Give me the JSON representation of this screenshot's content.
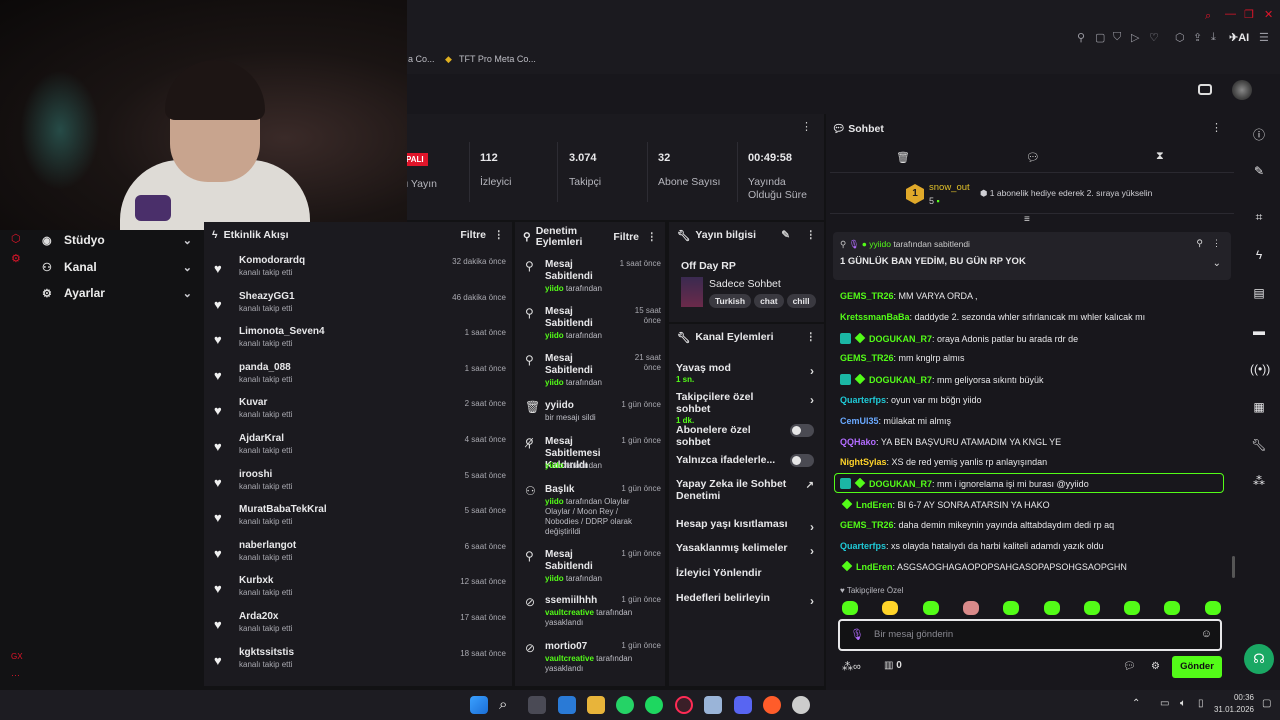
{
  "browser": {
    "tabs": [
      {
        "label": "a Co..."
      },
      {
        "label": "TFT Pro Meta Co..."
      }
    ],
    "ai_label": "AI"
  },
  "sidebar": {
    "items": [
      {
        "label": "Stüdyo",
        "icon": "camera-icon"
      },
      {
        "label": "Kanal",
        "icon": "people-icon"
      },
      {
        "label": "Ayarlar",
        "icon": "gear-icon"
      }
    ]
  },
  "stats": {
    "status_badge": "PALI",
    "items": [
      {
        "value": "",
        "label": "lu Yayın"
      },
      {
        "value": "112",
        "label": "İzleyici"
      },
      {
        "value": "3.074",
        "label": "Takipçi"
      },
      {
        "value": "32",
        "label": "Abone Sayısı"
      },
      {
        "value": "00:49:58",
        "label": "Yayında Olduğu Süre"
      }
    ]
  },
  "activity": {
    "title": "Etkinlik Akışı",
    "filter": "Filtre",
    "items": [
      {
        "name": "Komodorardq",
        "sub": "kanalı takip etti",
        "time": "32 dakika önce"
      },
      {
        "name": "SheazyGG1",
        "sub": "kanalı takip etti",
        "time": "46 dakika önce"
      },
      {
        "name": "Limonota_Seven4",
        "sub": "kanalı takip etti",
        "time": "1 saat önce"
      },
      {
        "name": "panda_088",
        "sub": "kanalı takip etti",
        "time": "1 saat önce"
      },
      {
        "name": "Kuvar",
        "sub": "kanalı takip etti",
        "time": "2 saat önce"
      },
      {
        "name": "AjdarKral",
        "sub": "kanalı takip etti",
        "time": "4 saat önce"
      },
      {
        "name": "irooshi",
        "sub": "kanalı takip etti",
        "time": "5 saat önce"
      },
      {
        "name": "MuratBabaTekKral",
        "sub": "kanalı takip etti",
        "time": "5 saat önce"
      },
      {
        "name": "naberlangot",
        "sub": "kanalı takip etti",
        "time": "6 saat önce"
      },
      {
        "name": "Kurbxk",
        "sub": "kanalı takip etti",
        "time": "12 saat önce"
      },
      {
        "name": "Arda20x",
        "sub": "kanalı takip etti",
        "time": "17 saat önce"
      },
      {
        "name": "kgktssitstis",
        "sub": "kanalı takip etti",
        "time": "18 saat önce"
      }
    ]
  },
  "moderation": {
    "title": "Denetim Eylemleri",
    "filter": "Filtre",
    "items": [
      {
        "icon": "pin-icon",
        "name": "Mesaj Sabitlendi",
        "user": "yiido",
        "rest": "tarafından",
        "time": "1 saat önce"
      },
      {
        "icon": "pin-icon",
        "name": "Mesaj Sabitlendi",
        "user": "yiido",
        "rest": "tarafından",
        "time": "15 saat önce"
      },
      {
        "icon": "pin-icon",
        "name": "Mesaj Sabitlendi",
        "user": "yiido",
        "rest": "tarafından",
        "time": "21 saat önce"
      },
      {
        "icon": "trash-icon",
        "name": "yyiido",
        "user": "",
        "rest": "bir mesajı sildi",
        "time": "1 gün önce"
      },
      {
        "icon": "unpin-icon",
        "name": "Mesaj Sabitlemesi Kaldırıldı",
        "user": "yiido",
        "rest": "tarafından",
        "time": "1 gün önce"
      },
      {
        "icon": "title-icon",
        "name": "Başlık",
        "user": "yiido",
        "rest": "tarafından Olaylar Olaylar / Moon Rey / Nobodies / DDRP olarak değiştirildi",
        "time": "1 gün önce"
      },
      {
        "icon": "pin-icon",
        "name": "Mesaj Sabitlendi",
        "user": "yiido",
        "rest": "tarafından",
        "time": "1 gün önce"
      },
      {
        "icon": "ban-icon",
        "name": "ssemiilhhh",
        "user": "vaultcreative",
        "rest": "tarafından yasaklandı",
        "time": "1 gün önce"
      },
      {
        "icon": "ban-icon",
        "name": "mortio07",
        "user": "vaultcreative",
        "rest": "tarafından yasaklandı",
        "time": "1 gün önce"
      }
    ]
  },
  "stream_info": {
    "title": "Yayın bilgisi",
    "stream_title": "Off Day RP",
    "category": "Sadece Sohbet",
    "tags": [
      "Turkish",
      "chat",
      "chill"
    ]
  },
  "channel_actions": {
    "title": "Kanal Eylemleri",
    "items": [
      {
        "label": "Yavaş mod",
        "sub": "1 sn.",
        "control": "arrow"
      },
      {
        "label": "Takipçilere özel sohbet",
        "sub": "1 dk.",
        "control": "arrow"
      },
      {
        "label": "Abonelere özel sohbet",
        "sub": "",
        "control": "toggle"
      },
      {
        "label": "Yalnızca ifadelerle...",
        "sub": "",
        "control": "toggle"
      },
      {
        "label": "Yapay Zeka ile Sohbet Denetimi",
        "sub": "",
        "control": "external"
      },
      {
        "label": "Hesap yaşı kısıtlaması",
        "sub": "",
        "control": "arrow"
      },
      {
        "label": "Yasaklanmış kelimeler",
        "sub": "",
        "control": "arrow"
      },
      {
        "label": "İzleyici Yönlendir",
        "sub": "",
        "control": "none"
      },
      {
        "label": "Hedefleri belirleyin",
        "sub": "",
        "control": "arrow"
      }
    ]
  },
  "chat": {
    "title": "Sohbet",
    "leader": {
      "rank": "1",
      "name": "snow_out",
      "count": "5",
      "message": "1 abonelik hediye ederek 2. sıraya yükselin"
    },
    "pinned": {
      "user": "yyiido",
      "by": "tarafından sabitlendi",
      "text": "1 GÜNLÜK BAN YEDİM, BU GÜN RP YOK"
    },
    "messages": [
      {
        "user": "GEMS_TR26",
        "color": "#53fc18",
        "text": ": MM VARYA ORDA ,",
        "badges": ""
      },
      {
        "user": "KretssmanBaBa",
        "color": "#53fc18",
        "text": ": daddyde 2. sezonda whler sıfırlanıcak mı whler kalıcak mı",
        "badges": ""
      },
      {
        "user": "DOGUKAN_R7",
        "color": "#53fc18",
        "text": ": oraya Adonis patlar bu arada rdr de",
        "badges": "sub"
      },
      {
        "user": "GEMS_TR26",
        "color": "#53fc18",
        "text": ": mm knglrp almıs",
        "badges": ""
      },
      {
        "user": "DOGUKAN_R7",
        "color": "#53fc18",
        "text": ": mm geliyorsa sıkıntı büyük",
        "badges": "sub"
      },
      {
        "user": "Quarterfps",
        "color": "#1fc9d6",
        "text": ": oyun var mı böğn yiido",
        "badges": ""
      },
      {
        "user": "CemUl35",
        "color": "#6aa9ff",
        "text": ": mülakat mi almış",
        "badges": ""
      },
      {
        "user": "QQHako",
        "color": "#b26cff",
        "text": ": YA BEN BAŞVURU ATAMADIM YA KNGL YE",
        "badges": ""
      },
      {
        "user": "NightSylas",
        "color": "#ffd42a",
        "text": ": XS de red yemiş yanlis rp anlayışından",
        "badges": ""
      },
      {
        "user": "DOGUKAN_R7",
        "color": "#53fc18",
        "text": ": mm i ignorelama işi mi burası @yyiido",
        "badges": "sub"
      },
      {
        "user": "LndEren",
        "color": "#53fc18",
        "text": ": BI 6-7 AY SONRA ATARSIN YA HAKO",
        "badges": "gift"
      },
      {
        "user": "GEMS_TR26",
        "color": "#53fc18",
        "text": ": daha demin mikeynin yayında alttabdaydım dedi rp aq",
        "badges": ""
      },
      {
        "user": "Quarterfps",
        "color": "#1fc9d6",
        "text": ": xs olayda hatalıydı da harbi kaliteli adamdı yazık oldu",
        "badges": ""
      },
      {
        "user": "LndEren",
        "color": "#53fc18",
        "text": ": ASGSAOGHAGAOPOPSAHGASOPAPSOHGSAOPGHN",
        "badges": "gift"
      }
    ],
    "emote_section": "Takipçilere Özel",
    "input_placeholder": "Bir mesaj gönderin",
    "points": "0",
    "send_label": "Gönder"
  },
  "taskbar": {
    "time": "00:36",
    "date": "31.01.2026"
  },
  "colors": {
    "accent": "#53fc18",
    "panel": "#1b1a1f",
    "live": "#e0152a"
  }
}
